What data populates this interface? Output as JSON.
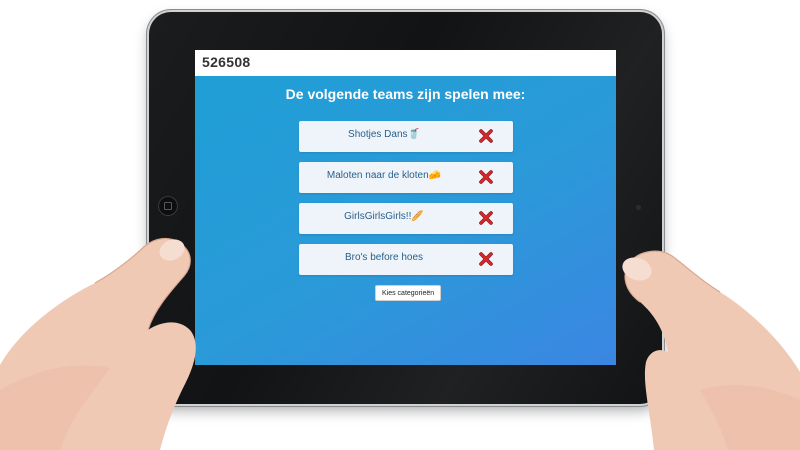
{
  "app": {
    "game_code": "526508"
  },
  "main": {
    "heading": "De volgende teams zijn spelen mee:",
    "teams": [
      {
        "name": "Shotjes Dans",
        "emoji": "🥤"
      },
      {
        "name": "Maloten naar de kloten",
        "emoji": "🧀"
      },
      {
        "name": "GirlsGirlsGirls!!",
        "emoji": "🥖"
      },
      {
        "name": "Bro's before hoes",
        "emoji": ""
      }
    ],
    "remove_icon": "close-icon",
    "category_button_label": "Kies categorieën"
  },
  "colors": {
    "screen_gradient_start": "#1f9fd6",
    "screen_gradient_end": "#3b86e3",
    "card_background": "#eef4f9",
    "team_text": "#2a5f8c",
    "remove_icon_red": "#d9262a"
  }
}
